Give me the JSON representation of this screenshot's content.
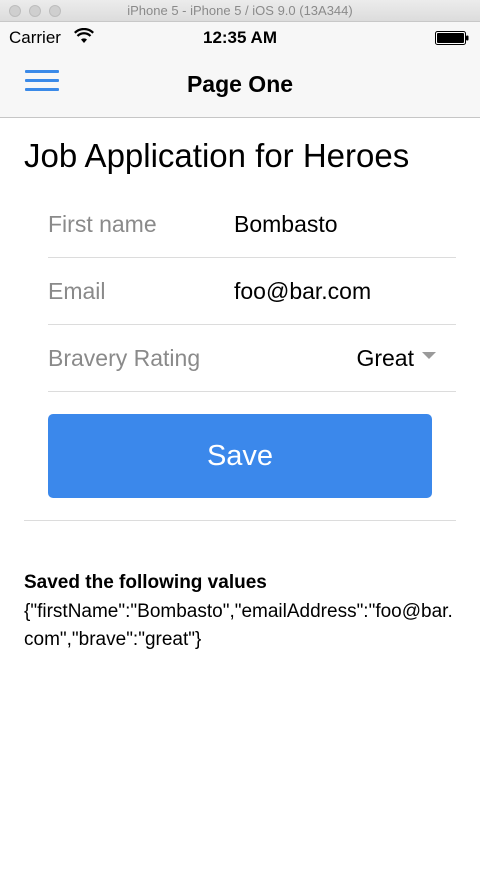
{
  "simulator": {
    "title": "iPhone 5 - iPhone 5 / iOS 9.0 (13A344)"
  },
  "status_bar": {
    "carrier": "Carrier",
    "time": "12:35 AM"
  },
  "nav": {
    "title": "Page One"
  },
  "page": {
    "heading": "Job Application for Heroes"
  },
  "form": {
    "first_name": {
      "label": "First name",
      "value": "Bombasto"
    },
    "email": {
      "label": "Email",
      "value": "foo@bar.com"
    },
    "bravery": {
      "label": "Bravery Rating",
      "value": "Great"
    }
  },
  "save_button": {
    "label": "Save"
  },
  "result": {
    "title": "Saved the following values",
    "json": "{\"firstName\":\"Bombasto\",\"emailAddress\":\"foo@bar.com\",\"brave\":\"great\"}"
  },
  "colors": {
    "accent": "#3b88eb",
    "label_gray": "#8a8a8a"
  }
}
